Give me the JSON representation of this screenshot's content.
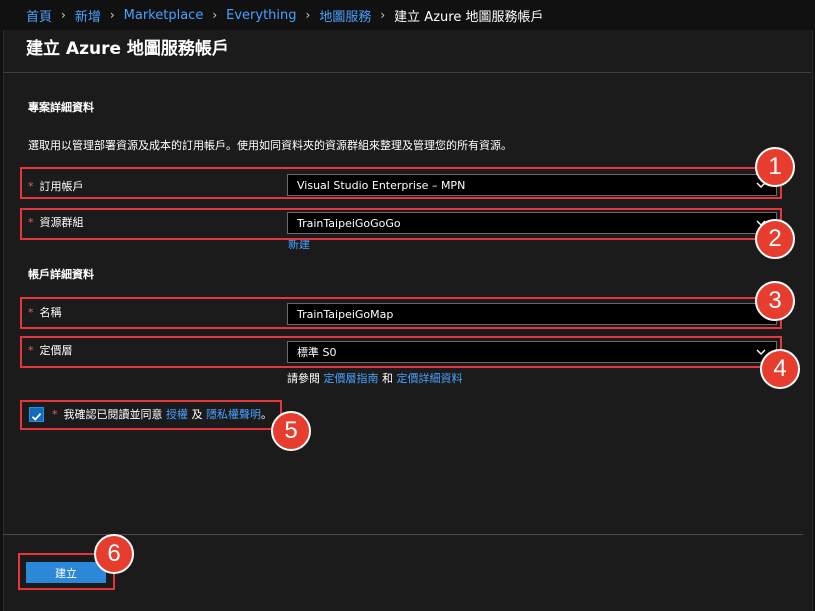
{
  "breadcrumb": {
    "items": [
      "首頁",
      "新增",
      "Marketplace",
      "Everything",
      "地圖服務"
    ],
    "current": "建立 Azure 地圖服務帳戶",
    "separator": "›"
  },
  "page": {
    "title": "建立 Azure 地圖服務帳戶"
  },
  "project": {
    "heading": "專案詳細資料",
    "description": "選取用以管理部署資源及成本的訂用帳戶。使用如同資料夾的資源群組來整理及管理您的所有資源。",
    "subscription": {
      "label": "訂用帳戶",
      "value": "Visual Studio Enterprise – MPN"
    },
    "resource_group": {
      "label": "資源群組",
      "value": "TrainTaipeiGoGoGo",
      "new_link": "新建"
    }
  },
  "account": {
    "heading": "帳戶詳細資料",
    "name": {
      "label": "名稱",
      "value": "TrainTaipeiGoMap"
    },
    "pricing": {
      "label": "定價層",
      "value": "標準 S0",
      "ref_prefix": "請參閱",
      "guide_link": "定價層指南",
      "and_text": "和",
      "details_link": "定價詳細資料"
    }
  },
  "agreement": {
    "text": "我確認已閱讀並同意",
    "license_link": "授權",
    "and_text": "及",
    "privacy_link": "隱私權聲明",
    "trail": "。",
    "checked": true
  },
  "required_mark": "*",
  "actions": {
    "create_label": "建立"
  },
  "annotations": [
    "1",
    "2",
    "3",
    "4",
    "5",
    "6"
  ],
  "colors": {
    "accent": "#2b88d8",
    "link": "#4aa1ff",
    "highlight": "#e8353b",
    "badge": "#e63d2e"
  }
}
